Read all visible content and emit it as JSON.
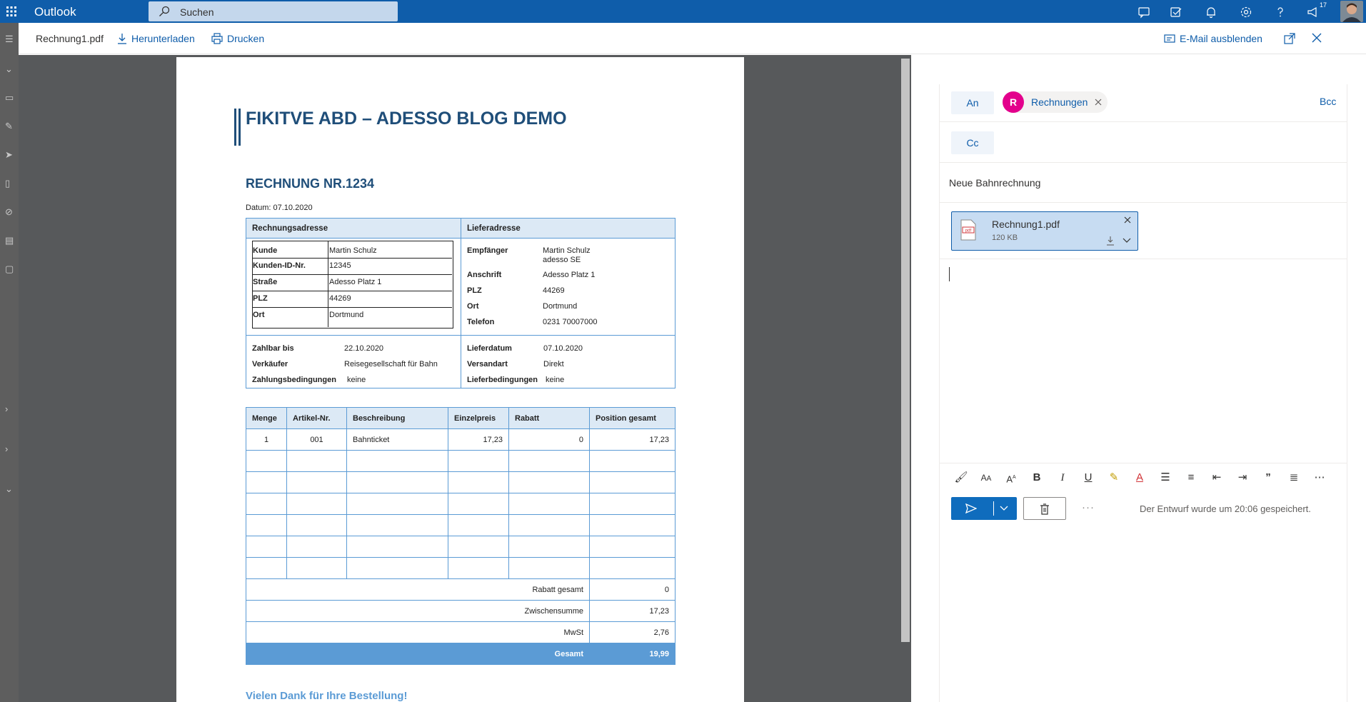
{
  "topbar": {
    "app_name": "Outlook",
    "search_placeholder": "Suchen",
    "badge_count": "17"
  },
  "viewer": {
    "file_name": "Rechnung1.pdf",
    "download_label": "Herunterladen",
    "print_label": "Drucken",
    "hide_email_label": "E-Mail ausblenden"
  },
  "pdf": {
    "title": "FIKITVE ABD – ADESSO BLOG DEMO",
    "invoice_number": "RECHNUNG NR.1234",
    "date": "Datum: 07.10.2020",
    "billing_header": "Rechnungsadresse",
    "delivery_header": "Lieferadresse",
    "billing": [
      {
        "label": "Kunde",
        "value": "Martin Schulz"
      },
      {
        "label": "Kunden-ID-Nr.",
        "value": "12345"
      },
      {
        "label": "Straße",
        "value": "Adesso Platz 1"
      },
      {
        "label": "PLZ",
        "value": "44269"
      },
      {
        "label": "Ort",
        "value": "Dortmund"
      }
    ],
    "delivery": {
      "recipient_label": "Empfänger",
      "recipient_value_1": "Martin Schulz",
      "recipient_value_2": "adesso SE",
      "address_label": "Anschrift",
      "address_value": "Adesso Platz 1",
      "plz_label": "PLZ",
      "plz_value": "44269",
      "city_label": "Ort",
      "city_value": "Dortmund",
      "phone_label": "Telefon",
      "phone_value": "0231 70007000"
    },
    "terms_left": [
      {
        "label": "Zahlbar bis",
        "value": "22.10.2020"
      },
      {
        "label": "Verkäufer",
        "value": "Reisegesellschaft für Bahn"
      },
      {
        "label": "Zahlungsbedingungen",
        "value": "keine"
      }
    ],
    "terms_right": [
      {
        "label": "Lieferdatum",
        "value": "07.10.2020"
      },
      {
        "label": "Versandart",
        "value": "Direkt"
      },
      {
        "label": "Lieferbedingungen",
        "value": "keine"
      }
    ],
    "items_headers": [
      "Menge",
      "Artikel-Nr.",
      "Beschreibung",
      "Einzelpreis",
      "Rabatt",
      "Position gesamt"
    ],
    "items": [
      [
        "1",
        "001",
        "Bahnticket",
        "17,23",
        "0",
        "17,23"
      ]
    ],
    "totals": [
      {
        "label": "Rabatt gesamt",
        "value": "0"
      },
      {
        "label": "Zwischensumme",
        "value": "17,23"
      },
      {
        "label": "MwSt",
        "value": "2,76"
      }
    ],
    "grand_total_label": "Gesamt",
    "grand_total_value": "19,99",
    "thanks": "Vielen Dank für Ihre Bestellung!"
  },
  "compose": {
    "to_label": "An",
    "cc_label": "Cc",
    "bcc_label": "Bcc",
    "recipient_initial": "R",
    "recipient_name": "Rechnungen",
    "subject": "Neue Bahnrechnung",
    "attachment_name": "Rechnung1.pdf",
    "attachment_size": "120 KB",
    "saved_status": "Der Entwurf wurde um 20:06 gespeichert."
  },
  "colors": {
    "brand": "#0f5daa",
    "title_blue": "#1f4e79",
    "table_border": "#5b9bd5",
    "avatar_pink": "#e3008c"
  }
}
